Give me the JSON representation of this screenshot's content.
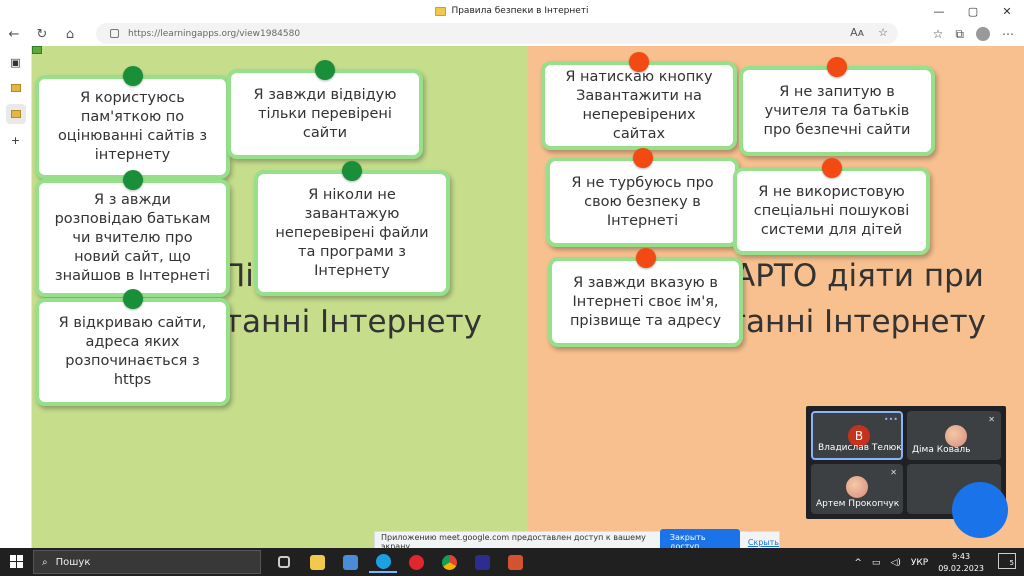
{
  "window": {
    "title": "Правила безпеки в Інтернеті",
    "min": "—",
    "max": "▢",
    "close": "✕"
  },
  "address_bar": {
    "url": "https://learningapps.org/view1984580",
    "read_aloud": "Aᴀ",
    "favorite": "☆",
    "collections": "⧉"
  },
  "board": {
    "left_title_line1": "Пі",
    "left_title_line2": "танні Інтернету",
    "right_title_line1": "АРТО діяти при",
    "right_title_line2": "танні Інтернету",
    "green_cards": [
      "Я користуюсь пам'яткою по оцінюванні сайтів з інтернету",
      "Я завжди відвідую тільки перевірені сайти",
      "Я з авжди розповідаю батькам чи вчителю про новий сайт, що знайшов в Інтернеті",
      "Я ніколи не завантажую неперевірені файли та програми з Інтернету",
      "Я відкриваю сайти, адреса яких розпочинається з https"
    ],
    "red_cards": [
      "Я натискаю кнопку Завантажити на неперевірених сайтах",
      "Я не запитую в учителя та батьків про безпечні сайти",
      "Я не турбуюсь про свою безпеку в Інтернеті",
      "Я не використовую спеціальні пошукові системи для дітей",
      "Я завжди вказую в Інтернеті своє ім'я, прізвище та адресу"
    ],
    "colors": {
      "green_zone": "#c6dd8c",
      "orange_zone": "#f7c08e",
      "card_border": "#97e08b",
      "pin_green": "#1a8f3a",
      "pin_red": "#f24a12"
    }
  },
  "meet": {
    "participants": [
      {
        "name": "Владислав Телюк",
        "initial": "В",
        "active": true
      },
      {
        "name": "Діма Коваль"
      },
      {
        "name": "Артем Прокопчук"
      }
    ],
    "more": "•••",
    "muted_icon": "mic-off-icon"
  },
  "share_notice": {
    "text": "Приложению meet.google.com предоставлен доступ к вашему экрану.",
    "stop_button": "Закрыть доступ",
    "hide_link": "Скрыть"
  },
  "taskbar": {
    "search_placeholder": "Пошук",
    "language": "УКР",
    "time": "9:43",
    "date": "09.02.2023",
    "notifications": "5"
  }
}
